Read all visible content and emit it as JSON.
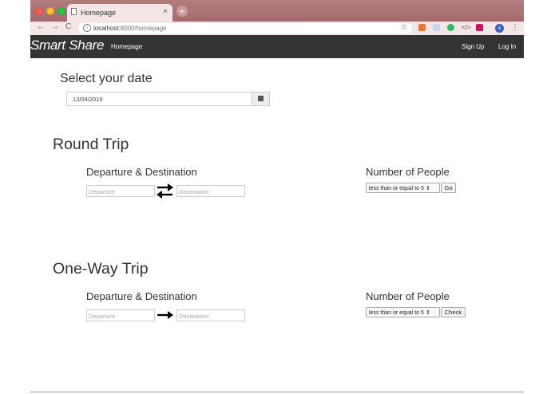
{
  "browser": {
    "tab_title": "Homepage",
    "tab_close": "×",
    "new_tab": "+",
    "url_host": "localhost",
    "url_path": ":8000/homepage",
    "back": "←",
    "forward": "→",
    "reload": "C",
    "star": "☆",
    "avatar": "x",
    "menu": "⋮"
  },
  "navbar": {
    "brand": "Smart Share",
    "home_link": "Homepage",
    "signup": "Sign Up",
    "login": "Log In"
  },
  "date_section": {
    "title": "Select your date",
    "value": "13/04/2019"
  },
  "round_trip": {
    "title": "Round Trip",
    "dep_dest_heading": "Departure & Destination",
    "departure_placeholder": "Departure",
    "destination_placeholder": "Destination",
    "people_heading": "Number of People",
    "people_select": "less than or equal to 5",
    "button": "Go"
  },
  "one_way": {
    "title": "One-Way Trip",
    "dep_dest_heading": "Departure & Destination",
    "departure_placeholder": "Departure",
    "destination_placeholder": "Destination",
    "people_heading": "Number of People",
    "people_select": "less than or equal to 5",
    "button": "Check"
  },
  "colors": {
    "chrome": "#a36a6c",
    "navbar": "#343434"
  }
}
